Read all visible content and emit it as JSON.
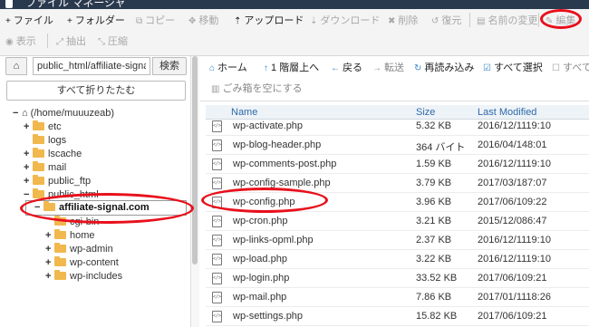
{
  "topbar": {
    "title": "ファイル マネージャ"
  },
  "toolbar": {
    "row1": [
      {
        "label": "ファイル",
        "icon": "plus-icon",
        "glyph": "+",
        "enabled": true
      },
      {
        "label": "フォルダー",
        "icon": "plus-icon",
        "glyph": "+",
        "enabled": true
      },
      {
        "label": "コピー",
        "icon": "copy-icon",
        "glyph": "⧉",
        "enabled": false
      },
      {
        "label": "移動",
        "icon": "move-icon",
        "glyph": "✥",
        "enabled": false
      },
      {
        "label": "アップロード",
        "icon": "upload-icon",
        "glyph": "⇡",
        "enabled": true
      },
      {
        "label": "ダウンロード",
        "icon": "download-icon",
        "glyph": "⇣",
        "enabled": false
      },
      {
        "label": "削除",
        "icon": "delete-icon",
        "glyph": "✖",
        "enabled": false
      },
      {
        "label": "復元",
        "icon": "restore-icon",
        "glyph": "↺",
        "enabled": false
      },
      {
        "label": "名前の変更",
        "icon": "rename-icon",
        "glyph": "▤",
        "enabled": false
      },
      {
        "label": "編集",
        "icon": "edit-icon",
        "glyph": "✎",
        "enabled": false
      }
    ],
    "row2": [
      {
        "label": "表示",
        "icon": "view-icon",
        "glyph": "◉",
        "enabled": false
      },
      {
        "label": "抽出",
        "icon": "extract-icon",
        "glyph": "⤢",
        "enabled": false
      },
      {
        "label": "圧縮",
        "icon": "compress-icon",
        "glyph": "⤡",
        "enabled": false
      }
    ]
  },
  "nav": {
    "path_value": "public_html/affiliate-signal",
    "search_label": "検索",
    "collapse_label": "すべて折りたたむ"
  },
  "tree": [
    {
      "label": "(/home/muuuzeab)",
      "toggle": "−",
      "home": true
    },
    {
      "label": "etc",
      "toggle": "+"
    },
    {
      "label": "logs",
      "toggle": ""
    },
    {
      "label": "lscache",
      "toggle": "+"
    },
    {
      "label": "mail",
      "toggle": "+"
    },
    {
      "label": "public_ftp",
      "toggle": "+"
    },
    {
      "label": "public_html",
      "toggle": "−"
    },
    {
      "label": "affiliate-signal.com",
      "toggle": "−",
      "selected": true
    },
    {
      "label": "cgi-bin",
      "toggle": ""
    },
    {
      "label": "home",
      "toggle": "+"
    },
    {
      "label": "wp-admin",
      "toggle": "+"
    },
    {
      "label": "wp-content",
      "toggle": "+"
    },
    {
      "label": "wp-includes",
      "toggle": "+"
    }
  ],
  "actions": {
    "home": "ホーム",
    "up": "1 階層上へ",
    "back": "戻る",
    "forward": "転送",
    "reload": "再読み込み",
    "select_all": "すべて選択",
    "unselect_all": "すべて",
    "empty_trash": "ごみ箱を空にする"
  },
  "columns": {
    "name": "Name",
    "size": "Size",
    "modified": "Last Modified"
  },
  "files": [
    {
      "name": "wp-activate.php",
      "size": "5.32 KB",
      "modified": "2016/12/1119:10"
    },
    {
      "name": "wp-blog-header.php",
      "size": "364 バイト",
      "modified": "2016/04/148:01"
    },
    {
      "name": "wp-comments-post.php",
      "size": "1.59 KB",
      "modified": "2016/12/1119:10"
    },
    {
      "name": "wp-config-sample.php",
      "size": "3.79 KB",
      "modified": "2017/03/187:07"
    },
    {
      "name": "wp-config.php",
      "size": "3.96 KB",
      "modified": "2017/06/109:22"
    },
    {
      "name": "wp-cron.php",
      "size": "3.21 KB",
      "modified": "2015/12/086:47"
    },
    {
      "name": "wp-links-opml.php",
      "size": "2.37 KB",
      "modified": "2016/12/1119:10"
    },
    {
      "name": "wp-load.php",
      "size": "3.22 KB",
      "modified": "2016/12/1119:10"
    },
    {
      "name": "wp-login.php",
      "size": "33.52 KB",
      "modified": "2017/06/109:21"
    },
    {
      "name": "wp-mail.php",
      "size": "7.86 KB",
      "modified": "2017/01/1118:26"
    },
    {
      "name": "wp-settings.php",
      "size": "15.82 KB",
      "modified": "2017/06/109:21"
    }
  ],
  "colors": {
    "accent": "#3a87c8",
    "highlight_ring": "#e8101c",
    "folder": "#f0b84d"
  }
}
